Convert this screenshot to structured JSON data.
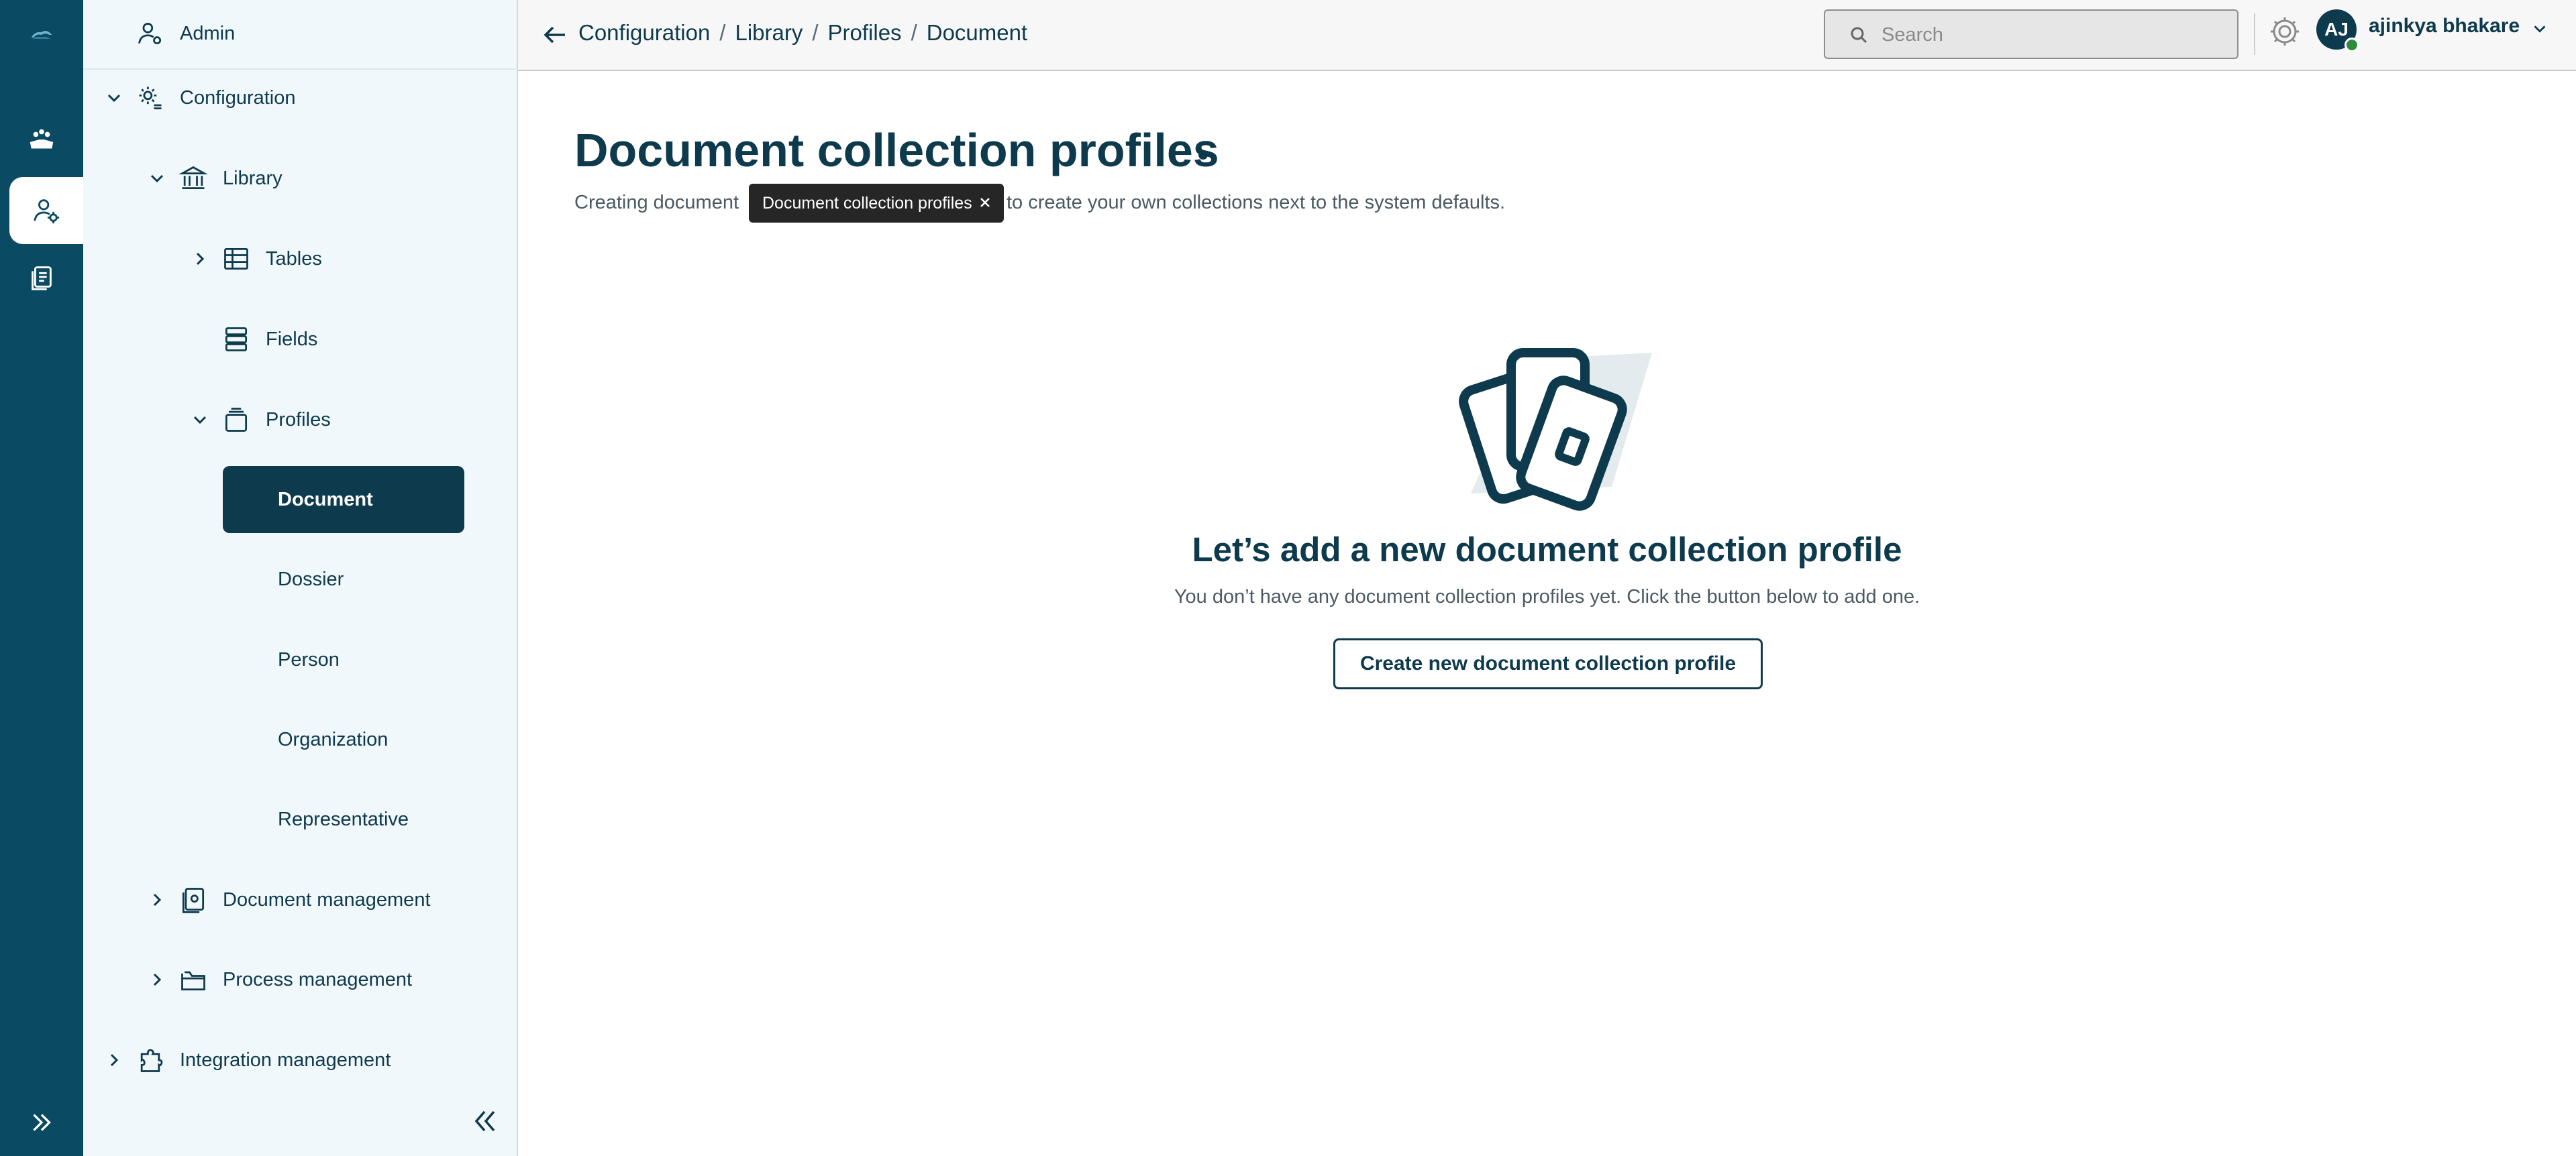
{
  "sidebar": {
    "admin_label": "Admin",
    "items": {
      "configuration": "Configuration",
      "library": "Library",
      "tables": "Tables",
      "fields": "Fields",
      "profiles": "Profiles",
      "document": "Document",
      "dossier": "Dossier",
      "person": "Person",
      "organization": "Organization",
      "representative": "Representative",
      "document_management": "Document management",
      "process_management": "Process management",
      "integration_management": "Integration management"
    },
    "active_item": "Document"
  },
  "header": {
    "breadcrumb": [
      "Configuration",
      "Library",
      "Profiles",
      "Document"
    ],
    "separator": "/",
    "search_placeholder": "Search",
    "user_initials": "AJ",
    "user_name": "ajinkya bhakare"
  },
  "main": {
    "title": "Document collection profiles",
    "description_start": "Creating document",
    "description_end": "to create your own collections next to the system defaults.",
    "tooltip": "Document collection profiles",
    "empty_title": "Let’s add a new document collection profile",
    "empty_text": "You don’t have any document collection profiles yet. Click the button below to add one.",
    "create_button": "Create new document collection profile"
  },
  "colors": {
    "navy": "#0b4a63",
    "dark": "#0e3a4d",
    "sidebar_bg": "#f1f8fb",
    "status_online": "#2e8b3e"
  }
}
